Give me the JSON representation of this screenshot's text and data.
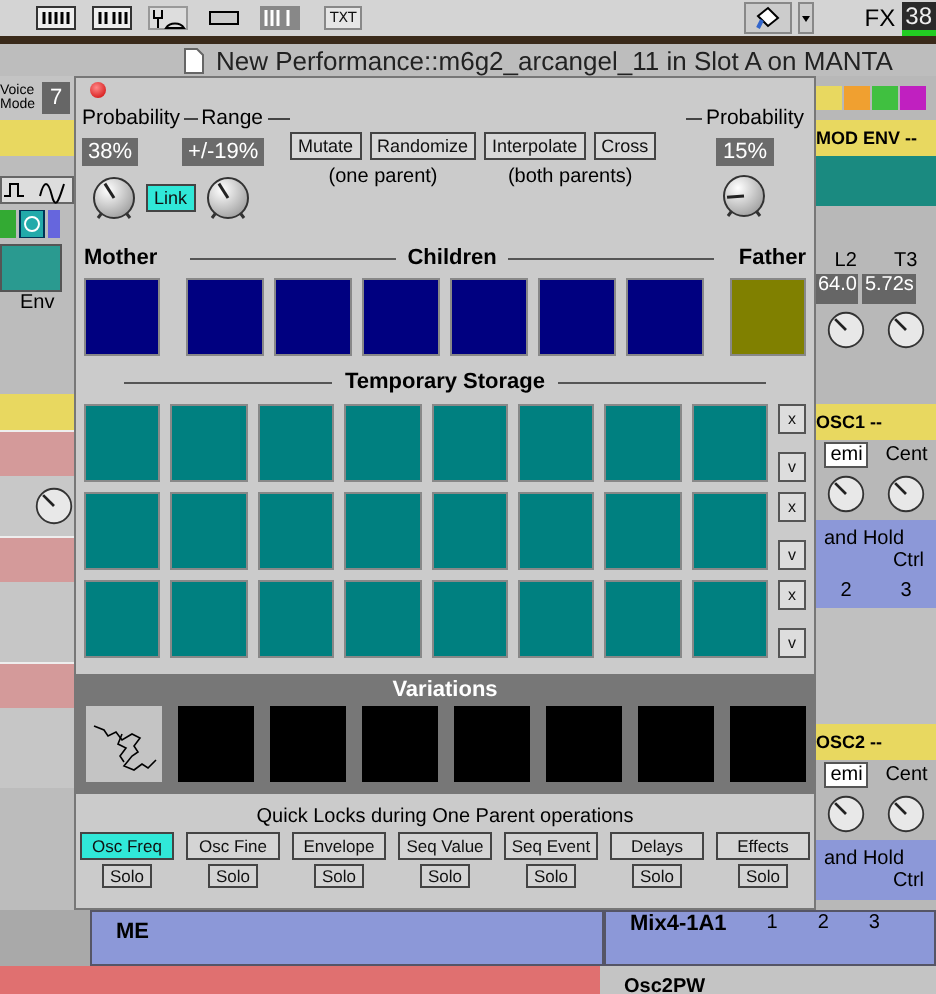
{
  "toolbar": {
    "txt_button": "TXT",
    "fx_label": "FX",
    "fx_value": "38"
  },
  "document_title": "New Performance::m6g2_arcangel_11 in Slot A on MANTA",
  "left_panel": {
    "voice_mode_label": "Voice Mode",
    "voice_mode_value": "7",
    "env_label": "Env"
  },
  "right_panel": {
    "mod_env_header": "MOD ENV --",
    "l2_label": "L2",
    "t3_label": "T3",
    "l2_value": "64.0",
    "t3_value": "5.72s",
    "osc1_header": "OSC1 --",
    "osc1_semi": "emi",
    "osc1_cent": "Cent",
    "osc1_mode": "and Hold",
    "osc1_ctrl": "Ctrl",
    "osc1_inputs": [
      "2",
      "3"
    ],
    "osc2_header": "OSC2 --",
    "osc2_semi": "emi",
    "osc2_cent": "Cent",
    "osc2_mode": "and Hold",
    "osc2_ctrl": "Ctrl"
  },
  "bottom_panels": {
    "left_module": "ME",
    "right_module": "Mix4-1A1",
    "right_inputs": [
      "1",
      "2",
      "3"
    ],
    "next_module": "Osc2PW"
  },
  "dialog": {
    "mutation": {
      "probability_label": "Probability",
      "range_label": "Range",
      "probability_value": "38%",
      "range_value": "+/-19%",
      "probability_knob": {
        "level": 0.38
      },
      "range_knob": {
        "level": 0.38
      },
      "link": {
        "label": "Link",
        "selected": true
      }
    },
    "operation_groups": [
      {
        "note": "(one parent)",
        "buttons": [
          "Mutate",
          "Randomize"
        ]
      },
      {
        "note": "(both parents)",
        "buttons": [
          "Interpolate",
          "Cross"
        ]
      }
    ],
    "cross": {
      "probability_label": "Probability",
      "probability_value": "15%",
      "knob": {
        "level": 0.15
      }
    },
    "mother": {
      "label": "Mother",
      "color": "#000080"
    },
    "children_label": "Children",
    "children": [
      {
        "color": "#000080"
      },
      {
        "color": "#000080"
      },
      {
        "color": "#000080"
      },
      {
        "color": "#000080"
      },
      {
        "color": "#000080"
      },
      {
        "color": "#000080"
      }
    ],
    "father": {
      "label": "Father",
      "color": "#808000"
    },
    "storage_label": "Temporary Storage",
    "storage_rows": [
      {
        "clear": "x",
        "store": "v"
      },
      {
        "clear": "x",
        "store": "v"
      },
      {
        "clear": "x",
        "store": "v"
      }
    ],
    "variations_label": "Variations",
    "variations": [
      {
        "kind": "drawing"
      },
      {
        "kind": "empty"
      },
      {
        "kind": "empty"
      },
      {
        "kind": "empty"
      },
      {
        "kind": "empty"
      },
      {
        "kind": "empty"
      },
      {
        "kind": "empty"
      },
      {
        "kind": "empty"
      }
    ],
    "quick_locks_label": "Quick Locks during One Parent operations",
    "locks": [
      {
        "label": "Osc Freq",
        "selected": true,
        "solo": {
          "label": "Solo",
          "selected": false
        }
      },
      {
        "label": "Osc Fine",
        "selected": false,
        "solo": {
          "label": "Solo",
          "selected": false
        }
      },
      {
        "label": "Envelope",
        "selected": false,
        "solo": {
          "label": "Solo",
          "selected": false
        }
      },
      {
        "label": "Seq Value",
        "selected": false,
        "solo": {
          "label": "Solo",
          "selected": false
        }
      },
      {
        "label": "Seq Event",
        "selected": false,
        "solo": {
          "label": "Solo",
          "selected": false
        }
      },
      {
        "label": "Delays",
        "selected": false,
        "solo": {
          "label": "Solo",
          "selected": false
        }
      },
      {
        "label": "Effects",
        "selected": false,
        "solo": {
          "label": "Solo",
          "selected": false
        }
      }
    ]
  }
}
